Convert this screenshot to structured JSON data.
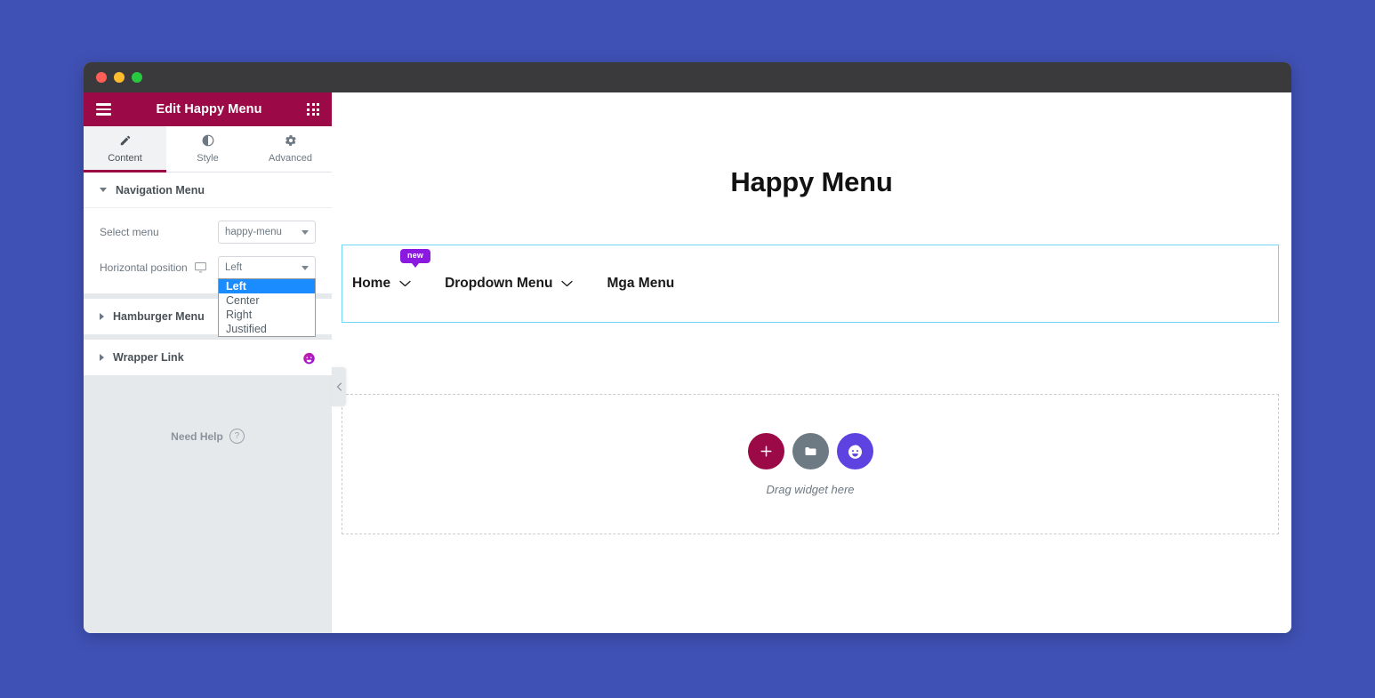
{
  "theme": {
    "desktop_background": "#3f51b5",
    "titlebar": "#3a3a3c",
    "panel_accent": "#9b0a46",
    "widget_border": "#71d7f7",
    "dropdown_highlight": "#1a8cff",
    "badge_purple": "#8b19e0",
    "ai_button": "#5f43e0",
    "folder_button": "#6e7a83"
  },
  "window": {
    "traffic_lights": [
      "close",
      "minimize",
      "maximize"
    ]
  },
  "panel": {
    "header": {
      "title": "Edit Happy Menu",
      "menu_icon": "hamburger-icon",
      "apps_icon": "grid-apps-icon"
    },
    "tabs": [
      {
        "label": "Content",
        "icon": "pencil-icon",
        "active": true
      },
      {
        "label": "Style",
        "icon": "contrast-icon",
        "active": false
      },
      {
        "label": "Advanced",
        "icon": "gear-icon",
        "active": false
      }
    ],
    "sections": [
      {
        "label": "Navigation Menu",
        "expanded": true,
        "controls": [
          {
            "label": "Select menu",
            "type": "select",
            "value": "happy-menu"
          },
          {
            "label": "Horizontal position",
            "type": "select",
            "value": "Left",
            "device_icon": "monitor-icon",
            "open": true,
            "options": [
              "Left",
              "Center",
              "Right",
              "Justified"
            ],
            "selected_option": "Left"
          }
        ]
      },
      {
        "label": "Hamburger Menu",
        "expanded": false
      },
      {
        "label": "Wrapper Link",
        "expanded": false,
        "badge_icon": "ai-face-icon"
      }
    ],
    "need_help": {
      "label": "Need Help",
      "icon": "question-mark-icon"
    },
    "collapse": {
      "icon": "chevron-left-icon"
    }
  },
  "canvas": {
    "heading": "Happy Menu",
    "menu_widget": {
      "items": [
        {
          "label": "Home",
          "has_submenu": true,
          "badge": "new"
        },
        {
          "label": "Dropdown Menu",
          "has_submenu": true
        },
        {
          "label": "Mga Menu",
          "has_submenu": false
        }
      ]
    },
    "dropzone": {
      "label": "Drag widget here",
      "buttons": [
        {
          "name": "add-element-button",
          "icon": "plus-icon"
        },
        {
          "name": "add-template-button",
          "icon": "folder-icon"
        },
        {
          "name": "ai-button",
          "icon": "ai-face-icon"
        }
      ]
    }
  }
}
